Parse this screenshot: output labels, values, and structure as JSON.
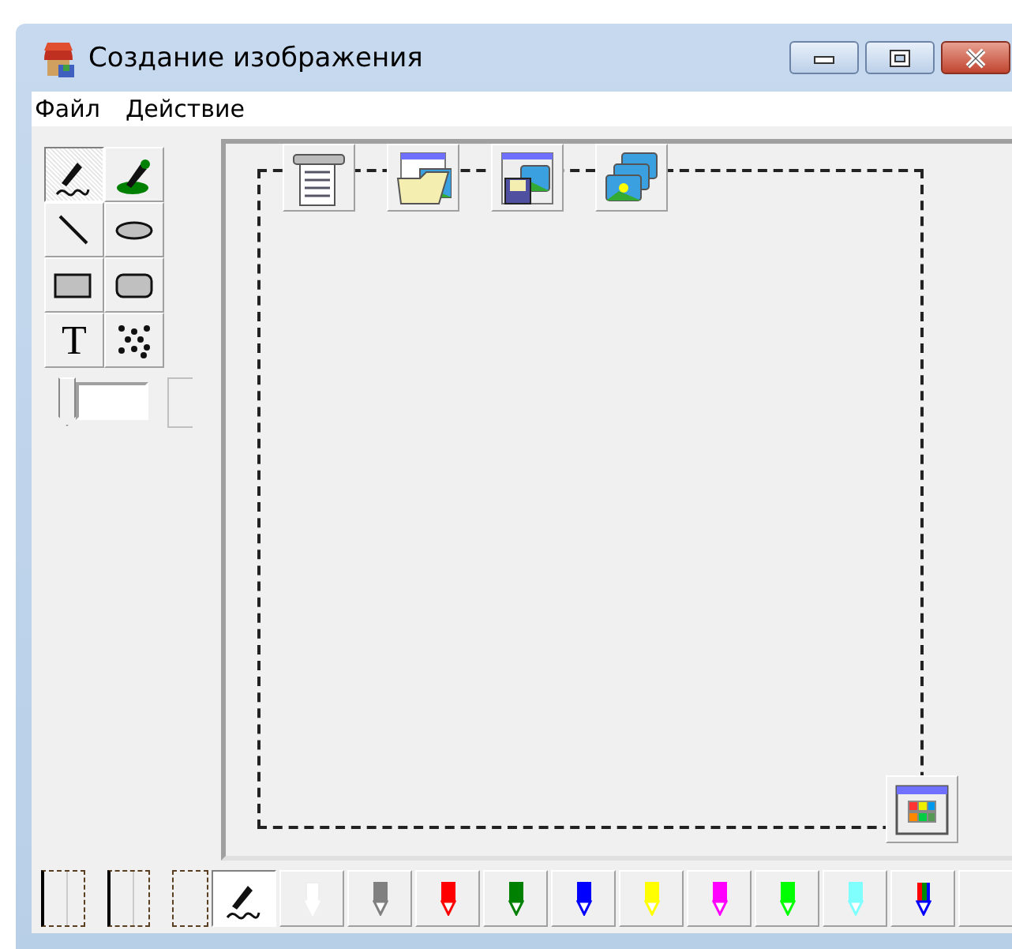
{
  "window": {
    "title": "Создание изображения"
  },
  "menu": [
    "Файл",
    "Действие"
  ],
  "tools": [
    {
      "kind": "pen",
      "selected": true
    },
    {
      "kind": "brush",
      "selected": false
    },
    {
      "kind": "line",
      "selected": false
    },
    {
      "kind": "ellipse",
      "selected": false
    },
    {
      "kind": "rect",
      "selected": false
    },
    {
      "kind": "roundrect",
      "selected": false
    },
    {
      "kind": "text",
      "label": "T",
      "selected": false
    },
    {
      "kind": "spray",
      "selected": false
    }
  ],
  "size_slider": {
    "level": 0
  },
  "canvas_buttons": [
    {
      "kind": "list"
    },
    {
      "kind": "open"
    },
    {
      "kind": "save"
    },
    {
      "kind": "gallery"
    }
  ],
  "palette": [
    {
      "kind": "pen",
      "selected": true
    },
    {
      "kind": "color",
      "color": "#ffffff",
      "selected": false
    },
    {
      "kind": "color",
      "color": "#808080",
      "selected": false
    },
    {
      "kind": "color",
      "color": "#ff0000",
      "selected": false
    },
    {
      "kind": "color",
      "color": "#008000",
      "selected": false
    },
    {
      "kind": "color",
      "color": "#0000ff",
      "selected": false
    },
    {
      "kind": "color",
      "color": "#ffff00",
      "selected": false
    },
    {
      "kind": "color",
      "color": "#ff00ff",
      "selected": false
    },
    {
      "kind": "color",
      "color": "#00ff00",
      "selected": false
    },
    {
      "kind": "color",
      "color": "#80ffff",
      "selected": false
    },
    {
      "kind": "multi",
      "selected": false
    },
    {
      "kind": "blank",
      "selected": false
    }
  ]
}
